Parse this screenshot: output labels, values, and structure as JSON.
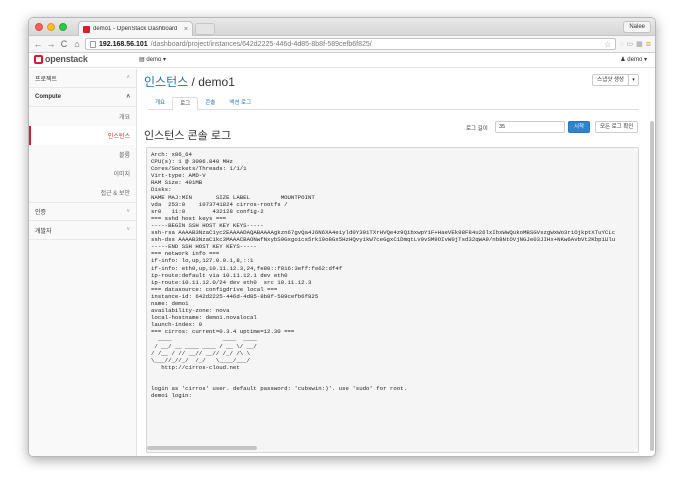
{
  "browser": {
    "tab_title": "demo1 - OpenStack Dashboard",
    "tab_close": "×",
    "profile": "Nalee",
    "url_host": "192.168.56.101",
    "url_path": "/dashboard/project/instances/642d2225-446d-4d85-8b8f-589cefb6f825/"
  },
  "header": {
    "logo_text": "openstack",
    "project_selector": "▤ demo ▾",
    "user_menu": "♟ demo ▾"
  },
  "sidebar": {
    "project_label": "프로젝트",
    "compute_label": "Compute",
    "items": [
      {
        "label": "개요"
      },
      {
        "label": "인스턴스"
      },
      {
        "label": "볼륨"
      },
      {
        "label": "이미지"
      },
      {
        "label": "접근 & 보안"
      }
    ],
    "identity_label": "인증",
    "developer_label": "개발자",
    "chev_up": "˄",
    "chev_down": "˅"
  },
  "page": {
    "breadcrumb": "인스턴스",
    "separator": "/",
    "instance_name": "demo1",
    "snapshot_button": "스냅샷 생성",
    "dropdown_caret": "▾",
    "tabs": [
      {
        "label": "개요"
      },
      {
        "label": "로그"
      },
      {
        "label": "콘솔"
      },
      {
        "label": "액션 로그"
      }
    ],
    "console_title": "인스턴스 콘솔 로그",
    "log_length_label": "로그 길이",
    "log_length_value": "35",
    "go_button": "시작",
    "view_full_button": "모든 로그 확인"
  },
  "console_lines": [
    "Arch: x86_64",
    "CPU(s): 1 @ 3096.840 MHz",
    "Cores/Sockets/Threads: 1/1/1",
    "Virt-type: AMD-V",
    "RAM Size: 491MB",
    "Disks:",
    "NAME MAJ:MIN       SIZE LABEL         MOUNTPOINT",
    "vda  253:0    1073741824 cirros-rootfs /",
    "sr0   11:0        432128 config-2",
    "=== sshd host keys ===",
    "-----BEGIN SSH HOST KEY KEYS-----",
    "ssh-rsa AAAAB3NzaC1yc2EAAAADAQABAAAAgkzn67gvQa4J6N6XA4eiyld0Y391TXrHVQe4z9QibxwpY1F+HaeVEk98F84u26lxIbxWwQukoMBSGVszgWxWo3riOjkptXTuYCLc",
    "ssh-dss AAAAB3NzaC1kc3MAAACBAONwfNxybS9Gxgoics5rk19o8Gx5HzHQvyikW7ceGgxC1DmqtLv9vSM9OIvW0jTsd32qWA9/nb8NtOVjNGJe03JIHx+NKw6AvbVt2Kbp1Ulu",
    "-----END SSH HOST KEY KEYS-----",
    "=== network info ===",
    "if-info: lo,up,127.0.0.1,8,::1",
    "if-info: eth0,up,10.11.12.3,24,fe80::f816:3eff:fe62:df4f",
    "ip-route:default via 10.11.12.1 dev eth0",
    "ip-route:10.11.12.0/24 dev eth0  src 10.11.12.3",
    "=== datasource: configdrive local ===",
    "instance-id: 642d2225-446d-4d85-8b8f-589cefb6f825",
    "name: demo1",
    "availability-zone: nova",
    "local-hostname: demo1.novalocal",
    "launch-index: 0",
    "=== cirros: current=0.3.4 uptime=12.30 ===",
    "  ____               ____  ____",
    " / __/ __ ____ ____ / __ \\/ __/",
    "/ /__ / // __// __// /_/ /\\ \\ ",
    "\\___//_//_/  /_/   \\____/___/ ",
    "   http://cirros-cloud.net",
    "",
    "",
    "login as 'cirros' user. default password: 'cubswin:)'. use 'sudo' for root.",
    "demo1 login:"
  ]
}
